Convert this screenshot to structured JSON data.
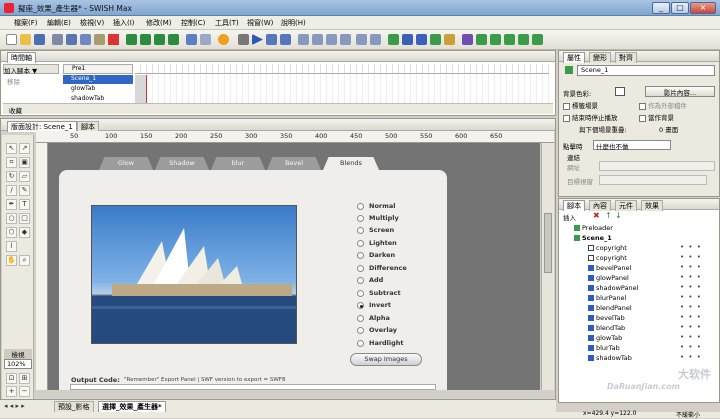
{
  "window": {
    "title": "擬座_效果_產生器* - SWISH Max",
    "controls": [
      "_",
      "□",
      "×"
    ]
  },
  "menu": [
    "檔案(F)",
    "編輯(E)",
    "檢視(V)",
    "插入(I)",
    "修改(M)",
    "控制(C)",
    "工具(T)",
    "視窗(W)",
    "說明(H)"
  ],
  "timeline": {
    "panel_title": "時間軸",
    "add_script_label": "加入腳本 ▼",
    "remove_label": "移除",
    "preset_label": "Pre1",
    "frame_numbers": [
      "1",
      "10",
      "20",
      "30",
      "40",
      "50",
      "60",
      "70",
      "80",
      "90",
      "100",
      "110",
      "120",
      "130",
      "140",
      "150"
    ],
    "rows": [
      "Scene_1",
      "glowTab",
      "shadowTab"
    ],
    "collapse_label": "收藏"
  },
  "layout": {
    "tabs": [
      "版面設計: Scene_1",
      "腳本"
    ],
    "ruler_marks": [
      "50",
      "100",
      "150",
      "200",
      "250",
      "300",
      "350",
      "400",
      "450",
      "500",
      "550",
      "600",
      "650"
    ],
    "zoom_label": "檢視",
    "zoom_value": "102%"
  },
  "stage": {
    "tabs": [
      "Glow",
      "Shadow",
      "blur",
      "Bevel",
      "Blends"
    ],
    "active_tab": "Blends",
    "blend_options": [
      {
        "label": "Normal",
        "selected": false
      },
      {
        "label": "Multiply",
        "selected": false
      },
      {
        "label": "Screen",
        "selected": false
      },
      {
        "label": "Lighten",
        "selected": false
      },
      {
        "label": "Darken",
        "selected": false
      },
      {
        "label": "Difference",
        "selected": false
      },
      {
        "label": "Add",
        "selected": false
      },
      {
        "label": "Subtract",
        "selected": false
      },
      {
        "label": "Invert",
        "selected": true
      },
      {
        "label": "Alpha",
        "selected": false
      },
      {
        "label": "Overlay",
        "selected": false
      },
      {
        "label": "Hardlight",
        "selected": false
      }
    ],
    "swap_button": "Swap Images",
    "output_code_label": "Output Code:",
    "output_code_value": "\"Remember\" Export Panel | SWF version to export = SWF8"
  },
  "bottom_tabs": [
    "預設_影格",
    "選擇_效果_產生器*"
  ],
  "status": {
    "coords": "x=429.4 y=122.0",
    "state": "不緩衝小"
  },
  "properties": {
    "tabs": [
      "屬性",
      "變形",
      "對齊"
    ],
    "scene_name": "Scene_1",
    "bg_label": "背景色彩:",
    "movie_button": "影片內容...",
    "checkbox_1": "標籤場景",
    "checkbox_2": "作為外部檔件",
    "checkbox_3": "結束時停止播放",
    "checkbox_4": "當作背景",
    "frame_label": "與下個場景重疊:",
    "frame_value": "0 畫面",
    "trigger_label": "點擊時",
    "trigger_value": "什麼也不做",
    "sub_label_1": "連結",
    "sub_label_2": "網址",
    "sub_label_3": "目標視窗"
  },
  "outline": {
    "tabs": [
      "腳本",
      "內容",
      "元件",
      "效果"
    ],
    "insert_label": "插入",
    "items": [
      {
        "name": "Preloader",
        "icon": "scene-icon"
      },
      {
        "name": "Scene_1",
        "icon": "scene-icon"
      },
      {
        "name": "copyright",
        "icon": "text-icon"
      },
      {
        "name": "copyright",
        "icon": "text-icon"
      },
      {
        "name": "bevelPanel",
        "icon": "sprite-icon"
      },
      {
        "name": "glowPanel",
        "icon": "sprite-icon"
      },
      {
        "name": "shadowPanel",
        "icon": "sprite-icon"
      },
      {
        "name": "blurPanel",
        "icon": "sprite-icon"
      },
      {
        "name": "blendPanel",
        "icon": "sprite-icon"
      },
      {
        "name": "bevelTab",
        "icon": "sprite-icon"
      },
      {
        "name": "blendTab",
        "icon": "sprite-icon"
      },
      {
        "name": "glowTab",
        "icon": "sprite-icon"
      },
      {
        "name": "blurTab",
        "icon": "sprite-icon"
      },
      {
        "name": "shadowTab",
        "icon": "sprite-icon"
      }
    ],
    "watermark": "DaRuanJian.com",
    "watermark_brand": "大软件"
  }
}
